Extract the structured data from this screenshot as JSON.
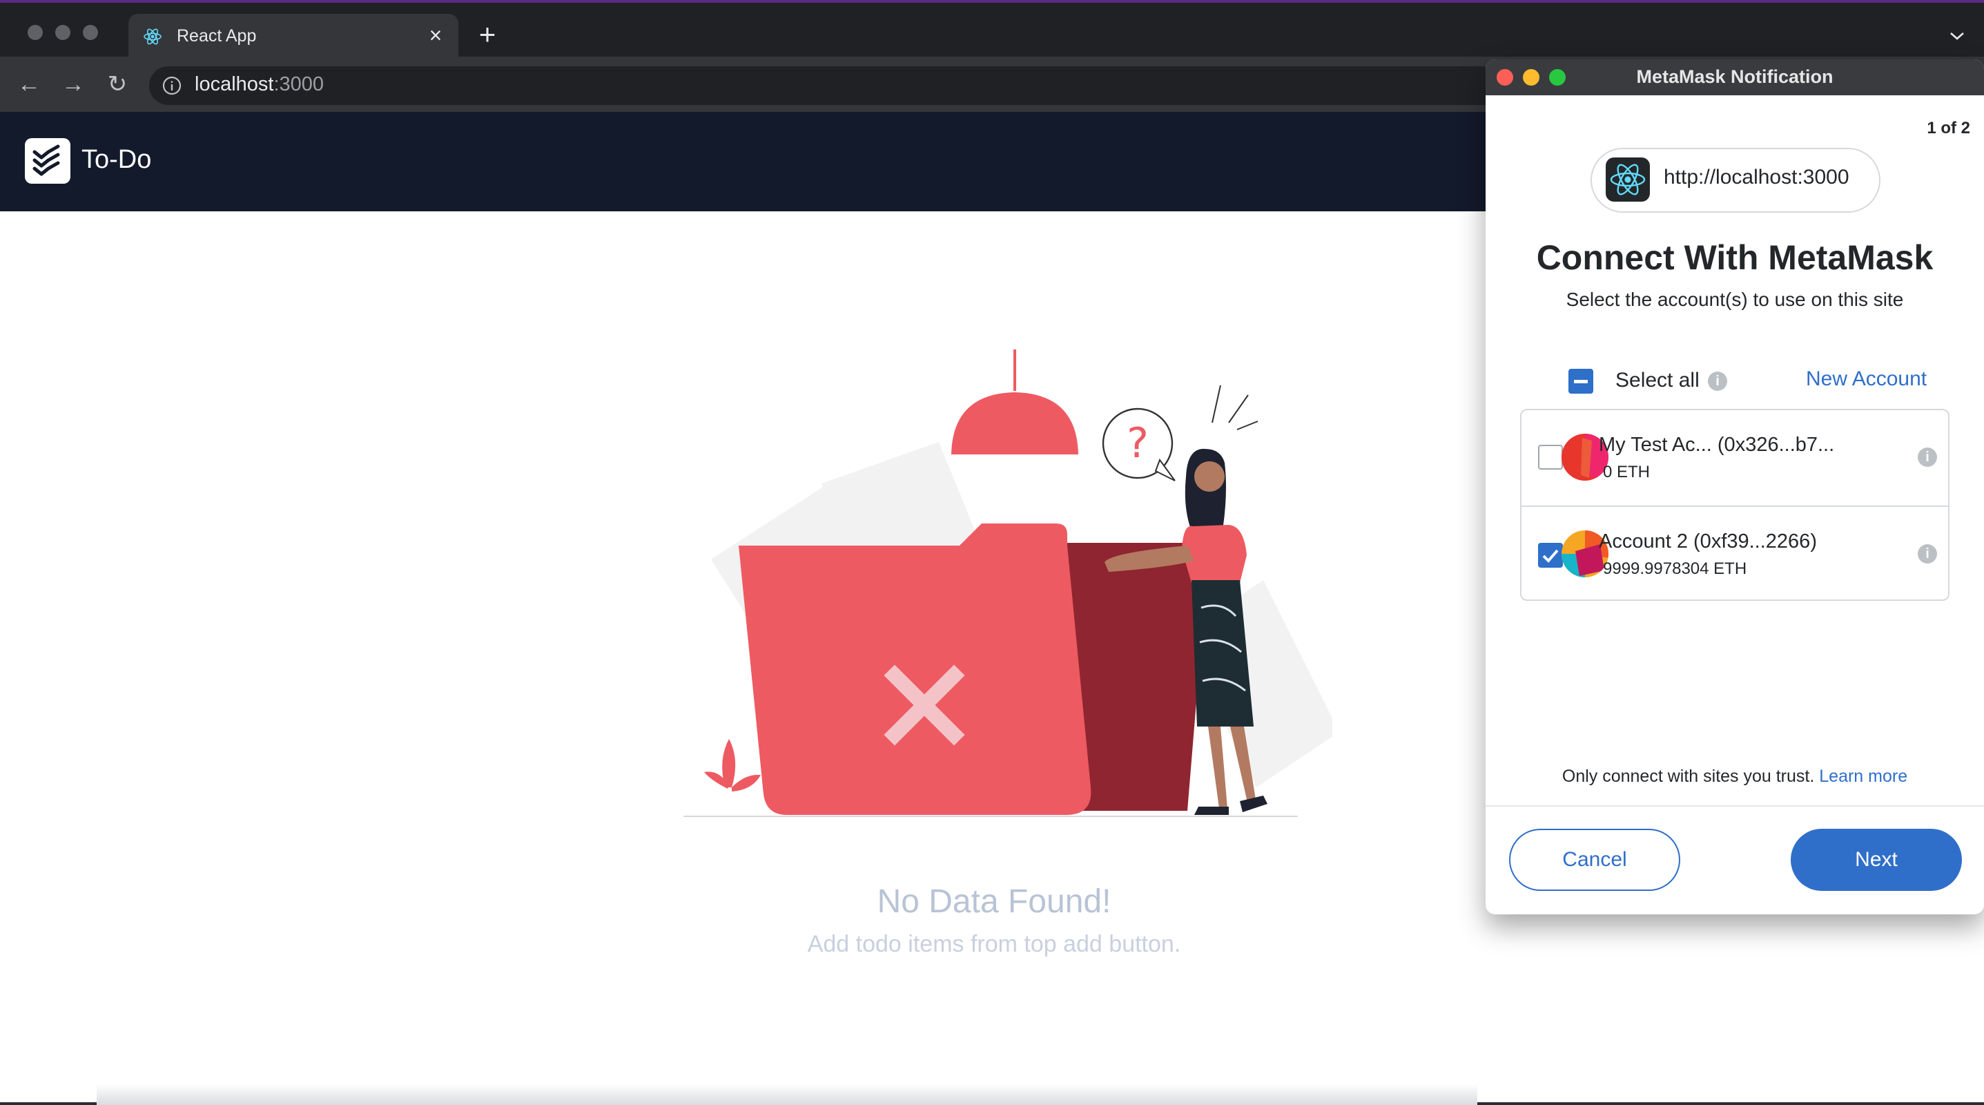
{
  "browser": {
    "tab_title": "React App",
    "url_host": "localhost",
    "url_port": ":3000"
  },
  "app": {
    "title": "To-Do",
    "empty_title": "No Data Found!",
    "empty_subtitle": "Add todo items from top add button."
  },
  "metamask": {
    "window_title": "MetaMask Notification",
    "page_count": "1 of 2",
    "origin": "http://localhost:3000",
    "heading": "Connect With MetaMask",
    "subheading": "Select the account(s) to use on this site",
    "select_all_label": "Select all",
    "new_account_label": "New Account",
    "accounts": [
      {
        "name": "My Test Ac... (0x326...b7...",
        "balance": "0 ETH",
        "checked": false
      },
      {
        "name": "Account 2 (0xf39...2266)",
        "balance": "9999.9978304 ETH",
        "checked": true
      }
    ],
    "trust_text": "Only connect with sites you trust.",
    "learn_more": "Learn more",
    "cancel_label": "Cancel",
    "next_label": "Next"
  },
  "colors": {
    "header_bg": "#131a2b",
    "accent_blue": "#2f6fc9",
    "folder_red": "#ee5a62",
    "folder_dark": "#8f2530"
  }
}
